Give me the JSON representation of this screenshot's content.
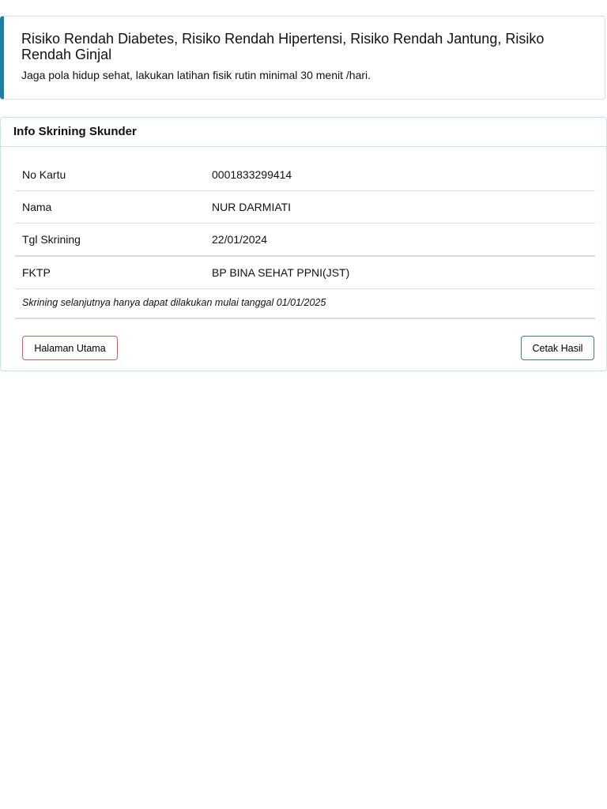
{
  "alert": {
    "title": "Risiko Rendah Diabetes, Risiko Rendah Hipertensi, Risiko Rendah Jantung, Risiko Rendah Ginjal",
    "message": "Jaga pola hidup sehat, lakukan latihan fisik rutin minimal 30 menit /hari.",
    "accent_color": "#1b7fa0"
  },
  "card": {
    "title": "Info Skrining Skunder",
    "rows": [
      {
        "label": "No Kartu",
        "value": "0001833299414"
      },
      {
        "label": "Nama",
        "value": "NUR DARMIATI"
      },
      {
        "label": "Tgl Skrining",
        "value": "22/01/2024"
      },
      {
        "label": "FKTP",
        "value": "BP BINA SEHAT PPNI(JST)"
      }
    ],
    "note": "Skrining selanjutnya hanya dapat dilakukan mulai tanggal 01/01/2025",
    "home_button": "Halaman Utama",
    "print_button": "Cetak Hasil"
  }
}
